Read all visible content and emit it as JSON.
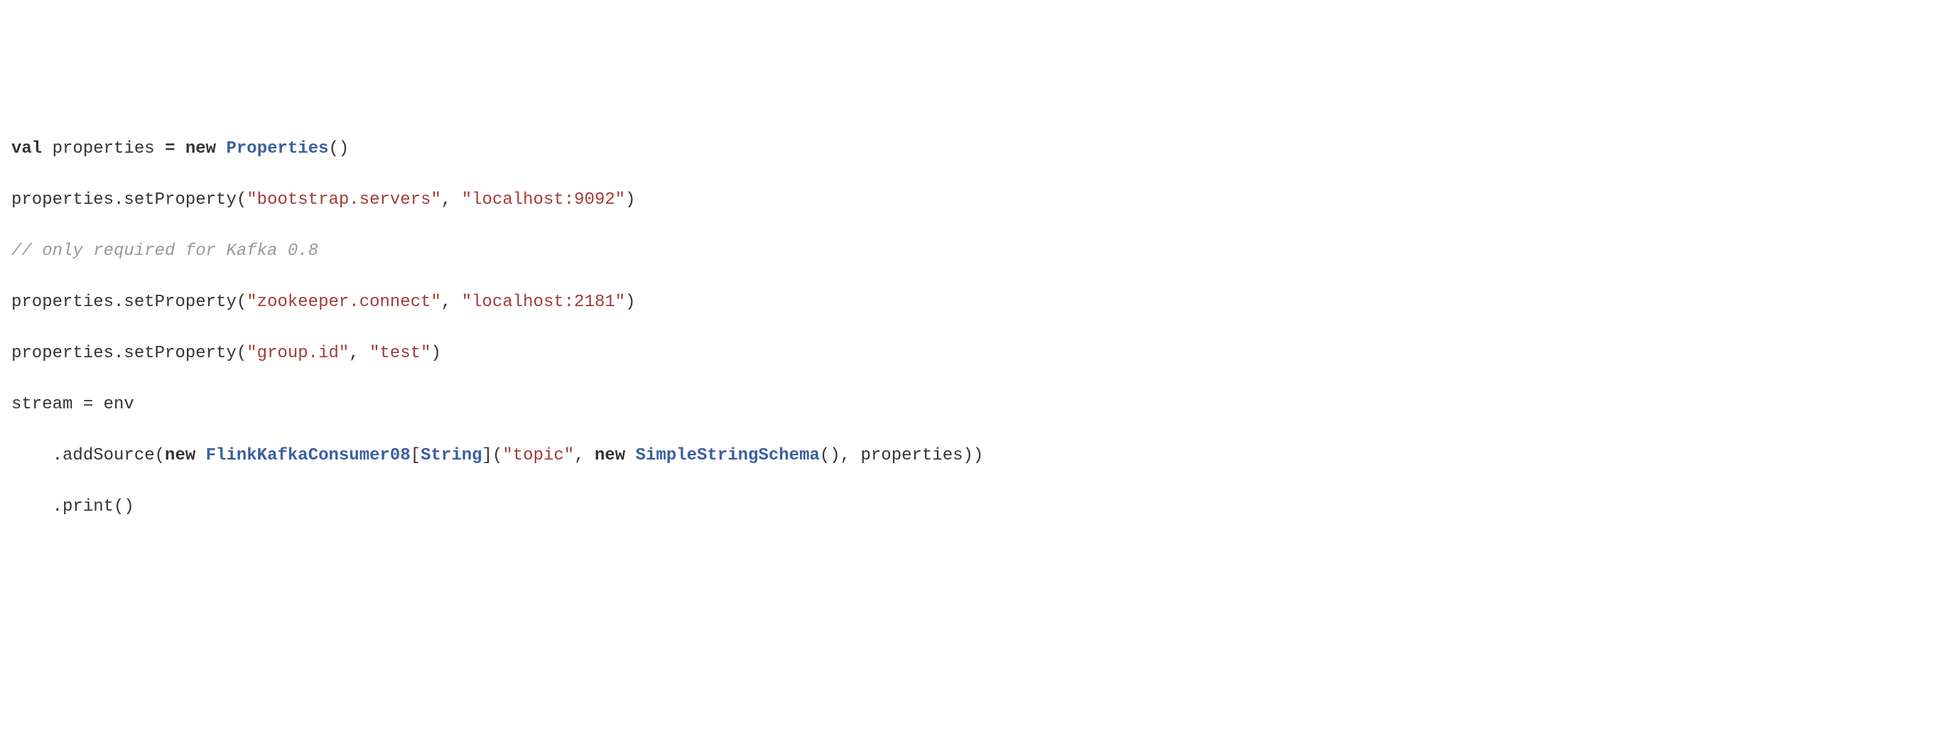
{
  "code": {
    "line1": {
      "kw_val": "val",
      "sp1": " ",
      "var1": "properties ",
      "op_eq": "=",
      "sp2": " ",
      "kw_new": "new",
      "sp3": " ",
      "type1": "Properties",
      "paren": "()"
    },
    "line2": {
      "prefix": "properties.setProperty(",
      "str1": "\"bootstrap.servers\"",
      "comma": ", ",
      "str2": "\"localhost:9092\"",
      "suffix": ")"
    },
    "line3": {
      "comment": "// only required for Kafka 0.8"
    },
    "line4": {
      "prefix": "properties.setProperty(",
      "str1": "\"zookeeper.connect\"",
      "comma": ", ",
      "str2": "\"localhost:2181\"",
      "suffix": ")"
    },
    "line5": {
      "prefix": "properties.setProperty(",
      "str1": "\"group.id\"",
      "comma": ", ",
      "str2": "\"test\"",
      "suffix": ")"
    },
    "line6": {
      "text": "stream = env"
    },
    "line7": {
      "indent": "    ",
      "prefix": ".addSource(",
      "kw_new": "new",
      "sp1": " ",
      "type1": "FlinkKafkaConsumer08",
      "bracket1": "[",
      "type2": "String",
      "bracket2": "](",
      "str1": "\"topic\"",
      "comma1": ", ",
      "kw_new2": "new",
      "sp2": " ",
      "type3": "SimpleStringSchema",
      "paren2": "(), properties))"
    },
    "line8": {
      "indent": "    ",
      "text": ".print()"
    }
  },
  "watermark": ""
}
